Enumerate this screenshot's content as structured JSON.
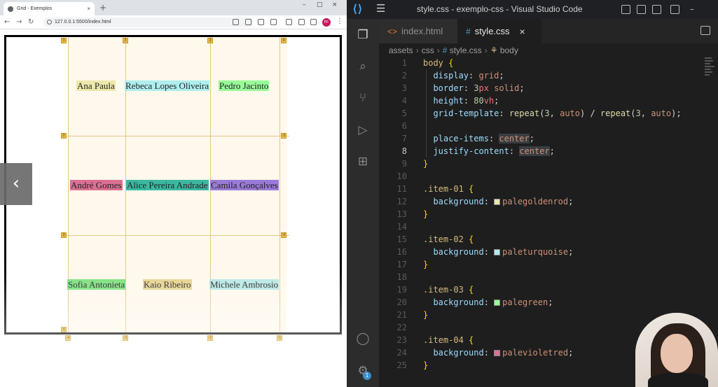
{
  "browser": {
    "tab_title": "Grid - Exemplos",
    "tab_close": "×",
    "new_tab": "+",
    "url": "127.0.0.1:5500/index.html",
    "profile_initials": "PF",
    "window_controls": [
      "–",
      "□",
      "×"
    ]
  },
  "grid_items": [
    {
      "name": "Ana Paula",
      "color": "#eee8aa"
    },
    {
      "name": "Rebeca Lopes Oliveira",
      "color": "#afeeee"
    },
    {
      "name": "Pedro Jacinto",
      "color": "#98fb98"
    },
    {
      "name": "André Gomes",
      "color": "#db7093"
    },
    {
      "name": "Alice Pereira Andrade",
      "color": "#3cb8a0"
    },
    {
      "name": "Camila Gonçalves",
      "color": "#9a7ad8"
    },
    {
      "name": "Sofia Antonieta",
      "color": "#7be07b"
    },
    {
      "name": "Kaio Ribeiro",
      "color": "#e6d28c"
    },
    {
      "name": "Michele Ambrosio",
      "color": "#b6e7e4"
    }
  ],
  "grid_line_markers": [
    "1",
    "2",
    "3",
    "4",
    "-1",
    "-2",
    "-3",
    "-4"
  ],
  "vscode": {
    "window_title": "style.css - exemplo-css - Visual Studio Code",
    "tabs": [
      {
        "label": "index.html",
        "icon": "html-icon"
      },
      {
        "label": "style.css",
        "icon": "css-icon",
        "close": "×"
      }
    ],
    "breadcrumbs": [
      "assets",
      "css",
      "style.css",
      "body"
    ],
    "activity_badge": "1",
    "code_lines": [
      {
        "n": "1",
        "text": "body {"
      },
      {
        "n": "2",
        "text": "  display: grid;"
      },
      {
        "n": "3",
        "text": "  border: 3px solid;"
      },
      {
        "n": "4",
        "text": "  height: 80vh;"
      },
      {
        "n": "5",
        "text": "  grid-template: repeat(3, auto) / repeat(3, auto);"
      },
      {
        "n": "6",
        "text": ""
      },
      {
        "n": "7",
        "text": "  place-items: center;"
      },
      {
        "n": "8",
        "text": "  justify-content: center;"
      },
      {
        "n": "9",
        "text": "}"
      },
      {
        "n": "10",
        "text": ""
      },
      {
        "n": "11",
        "text": ".item-01 {"
      },
      {
        "n": "12",
        "text": "  background: palegoldenrod;"
      },
      {
        "n": "13",
        "text": "}"
      },
      {
        "n": "14",
        "text": ""
      },
      {
        "n": "15",
        "text": ".item-02 {"
      },
      {
        "n": "16",
        "text": "  background: paleturquoise;"
      },
      {
        "n": "17",
        "text": "}"
      },
      {
        "n": "18",
        "text": ""
      },
      {
        "n": "19",
        "text": ".item-03 {"
      },
      {
        "n": "20",
        "text": "  background: palegreen;"
      },
      {
        "n": "21",
        "text": "}"
      },
      {
        "n": "22",
        "text": ""
      },
      {
        "n": "23",
        "text": ".item-04 {"
      },
      {
        "n": "24",
        "text": "  background: palevioletred;"
      },
      {
        "n": "25",
        "text": "}"
      }
    ],
    "current_line": "8"
  },
  "colors": {
    "vscode_bg": "#1e1e1e",
    "accent_blue": "#3ca1f0",
    "grid_overlay": "#fff8ec",
    "grid_line": "#e2c887"
  }
}
